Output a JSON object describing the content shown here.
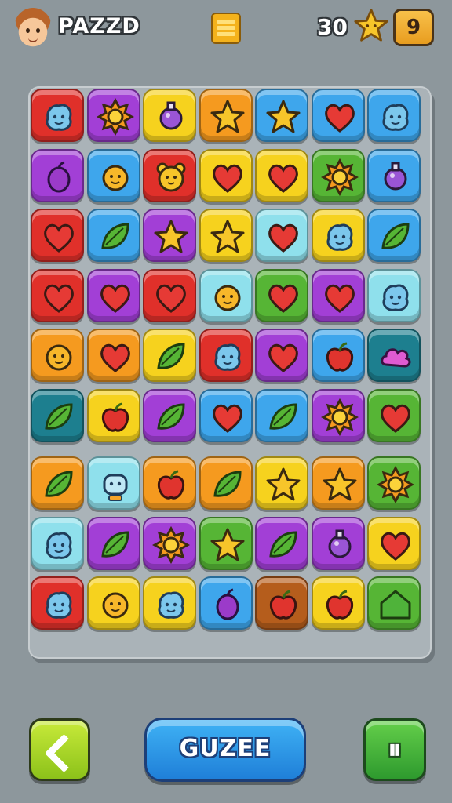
{
  "header": {
    "title": "PAZZD",
    "score": "30",
    "level": "9"
  },
  "footer": {
    "action_label": "GUZEE"
  },
  "colors": {
    "red": "#e0302a",
    "purple": "#a23fd6",
    "yellow": "#f6d21e",
    "orange": "#f59a1f",
    "blue": "#3ea6ec",
    "green": "#56b535",
    "cyan": "#8fe0ec",
    "teal": "#1d7f8f",
    "brown": "#b55d1c"
  },
  "board": {
    "rows": [
      [
        {
          "color": "red",
          "icon": "blob-face-icon"
        },
        {
          "color": "purple",
          "icon": "sun-icon"
        },
        {
          "color": "yellow",
          "icon": "potion-icon"
        },
        {
          "color": "orange",
          "icon": "star-icon"
        },
        {
          "color": "blue",
          "icon": "star-icon"
        },
        {
          "color": "blue",
          "icon": "heart-icon"
        },
        {
          "color": "blue",
          "icon": "blob-face-icon"
        }
      ],
      [
        {
          "color": "purple",
          "icon": "plum-icon"
        },
        {
          "color": "blue",
          "icon": "sun-face-icon"
        },
        {
          "color": "red",
          "icon": "bear-face-icon"
        },
        {
          "color": "yellow",
          "icon": "heart-icon"
        },
        {
          "color": "yellow",
          "icon": "heart-icon"
        },
        {
          "color": "green",
          "icon": "sun-icon"
        },
        {
          "color": "blue",
          "icon": "potion-icon"
        }
      ],
      [
        {
          "color": "red",
          "icon": "heart-icon"
        },
        {
          "color": "blue",
          "icon": "leaf-icon"
        },
        {
          "color": "purple",
          "icon": "star-icon"
        },
        {
          "color": "yellow",
          "icon": "star-icon"
        },
        {
          "color": "cyan",
          "icon": "heart-icon"
        },
        {
          "color": "yellow",
          "icon": "blob-face-icon"
        },
        {
          "color": "blue",
          "icon": "leaf-icon"
        }
      ],
      [
        {
          "color": "red",
          "icon": "heart-icon"
        },
        {
          "color": "purple",
          "icon": "heart-icon"
        },
        {
          "color": "red",
          "icon": "heart-icon"
        },
        {
          "color": "cyan",
          "icon": "sun-face-icon"
        },
        {
          "color": "green",
          "icon": "heart-icon"
        },
        {
          "color": "purple",
          "icon": "heart-icon"
        },
        {
          "color": "cyan",
          "icon": "blob-face-icon"
        }
      ],
      [
        {
          "color": "orange",
          "icon": "sun-face-icon"
        },
        {
          "color": "orange",
          "icon": "heart-icon"
        },
        {
          "color": "yellow",
          "icon": "leaf-icon"
        },
        {
          "color": "red",
          "icon": "blob-face-icon"
        },
        {
          "color": "purple",
          "icon": "heart-icon"
        },
        {
          "color": "blue",
          "icon": "apple-icon"
        },
        {
          "color": "teal",
          "icon": "cloud-icon"
        }
      ],
      [
        {
          "color": "teal",
          "icon": "leaf-icon"
        },
        {
          "color": "yellow",
          "icon": "apple-icon"
        },
        {
          "color": "purple",
          "icon": "leaf-icon"
        },
        {
          "color": "blue",
          "icon": "heart-icon"
        },
        {
          "color": "blue",
          "icon": "leaf-icon"
        },
        {
          "color": "purple",
          "icon": "sun-icon"
        },
        {
          "color": "green",
          "icon": "heart-icon"
        }
      ],
      [
        {
          "color": "orange",
          "icon": "leaf-icon"
        },
        {
          "color": "cyan",
          "icon": "robot-face-icon"
        },
        {
          "color": "orange",
          "icon": "apple-icon"
        },
        {
          "color": "orange",
          "icon": "leaf-icon"
        },
        {
          "color": "yellow",
          "icon": "star-icon"
        },
        {
          "color": "orange",
          "icon": "star-icon"
        },
        {
          "color": "green",
          "icon": "sun-icon"
        }
      ],
      [
        {
          "color": "cyan",
          "icon": "blob-face-icon"
        },
        {
          "color": "purple",
          "icon": "leaf-icon"
        },
        {
          "color": "purple",
          "icon": "sun-icon"
        },
        {
          "color": "green",
          "icon": "star-icon"
        },
        {
          "color": "purple",
          "icon": "leaf-icon"
        },
        {
          "color": "purple",
          "icon": "potion-icon"
        },
        {
          "color": "yellow",
          "icon": "heart-icon"
        }
      ],
      [
        {
          "color": "red",
          "icon": "blob-face-icon"
        },
        {
          "color": "yellow",
          "icon": "sun-face-icon"
        },
        {
          "color": "yellow",
          "icon": "blob-face-icon"
        },
        {
          "color": "blue",
          "icon": "plum-icon"
        },
        {
          "color": "brown",
          "icon": "apple-icon"
        },
        {
          "color": "yellow",
          "icon": "apple-icon"
        },
        {
          "color": "green",
          "icon": "house-icon"
        }
      ]
    ]
  }
}
